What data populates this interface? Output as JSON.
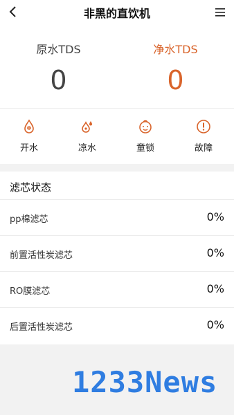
{
  "header": {
    "title": "非黑的直饮机",
    "back_icon": "back-arrow-icon",
    "menu_icon": "menu-icon"
  },
  "tds": {
    "raw_label": "原水TDS",
    "raw_value": "0",
    "pure_label": "净水TDS",
    "pure_value": "0",
    "accent_color": "#d9642b"
  },
  "actions": [
    {
      "label": "开水",
      "icon": "hot-water-icon"
    },
    {
      "label": "凉水",
      "icon": "cool-water-icon"
    },
    {
      "label": "童锁",
      "icon": "child-lock-icon"
    },
    {
      "label": "故障",
      "icon": "fault-icon"
    }
  ],
  "filters": {
    "title": "滤芯状态",
    "items": [
      {
        "name": "pp棉滤芯",
        "percent": "0%"
      },
      {
        "name": "前置活性炭滤芯",
        "percent": "0%"
      },
      {
        "name": "RO膜滤芯",
        "percent": "0%"
      },
      {
        "name": "后置活性炭滤芯",
        "percent": "0%"
      }
    ]
  },
  "watermark": "1233News"
}
